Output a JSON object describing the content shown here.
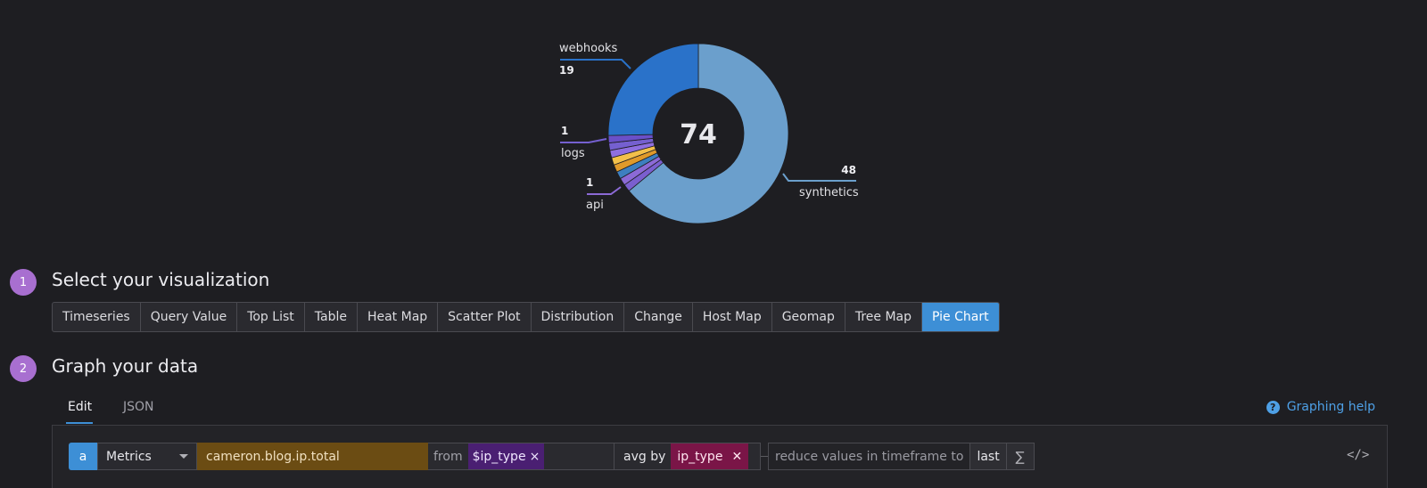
{
  "chart_data": {
    "type": "pie",
    "style": "donut",
    "total_label": "74",
    "slices": [
      {
        "name": "synthetics",
        "value": 48,
        "color": "#6b9fcc"
      },
      {
        "name": "",
        "value": 1,
        "color": "#7a5fcf"
      },
      {
        "name": "api",
        "value": 1,
        "color": "#8c6ad6"
      },
      {
        "name": "",
        "value": 1,
        "color": "#3d7fc0"
      },
      {
        "name": "",
        "value": 1,
        "color": "#e09a2a"
      },
      {
        "name": "",
        "value": 1,
        "color": "#f2c04a"
      },
      {
        "name": "",
        "value": 1,
        "color": "#8f6fe0"
      },
      {
        "name": "logs",
        "value": 1,
        "color": "#7560d0"
      },
      {
        "name": "",
        "value": 1,
        "color": "#6a50c8"
      },
      {
        "name": "webhooks",
        "value": 19,
        "color": "#2a72c9"
      }
    ],
    "callouts": [
      {
        "name": "webhooks",
        "value": "19"
      },
      {
        "name": "logs",
        "value": "1"
      },
      {
        "name": "api",
        "value": "1"
      },
      {
        "name": "synthetics",
        "value": "48"
      }
    ]
  },
  "steps": [
    {
      "number": "1",
      "title": "Select your visualization"
    },
    {
      "number": "2",
      "title": "Graph your data"
    }
  ],
  "visualizations": [
    {
      "label": "Timeseries",
      "active": false
    },
    {
      "label": "Query Value",
      "active": false
    },
    {
      "label": "Top List",
      "active": false
    },
    {
      "label": "Table",
      "active": false
    },
    {
      "label": "Heat Map",
      "active": false
    },
    {
      "label": "Scatter Plot",
      "active": false
    },
    {
      "label": "Distribution",
      "active": false
    },
    {
      "label": "Change",
      "active": false
    },
    {
      "label": "Host Map",
      "active": false
    },
    {
      "label": "Geomap",
      "active": false
    },
    {
      "label": "Tree Map",
      "active": false
    },
    {
      "label": "Pie Chart",
      "active": true
    }
  ],
  "tabs": {
    "edit": "Edit",
    "json": "JSON"
  },
  "help": {
    "label": "Graphing help",
    "icon": "question-icon"
  },
  "query": {
    "letter": "a",
    "source": "Metrics",
    "metric": "cameron.blog.ip.total",
    "from_label": "from",
    "from_tag": "$ip_type",
    "from_tag_remove": "×",
    "avg_label": "avg by",
    "group_tag": "ip_type",
    "group_tag_remove": "✕",
    "reduce_label": "reduce values in timeframe to",
    "reduce_value": "last",
    "sigma": "∑",
    "code_toggle": "</>"
  }
}
